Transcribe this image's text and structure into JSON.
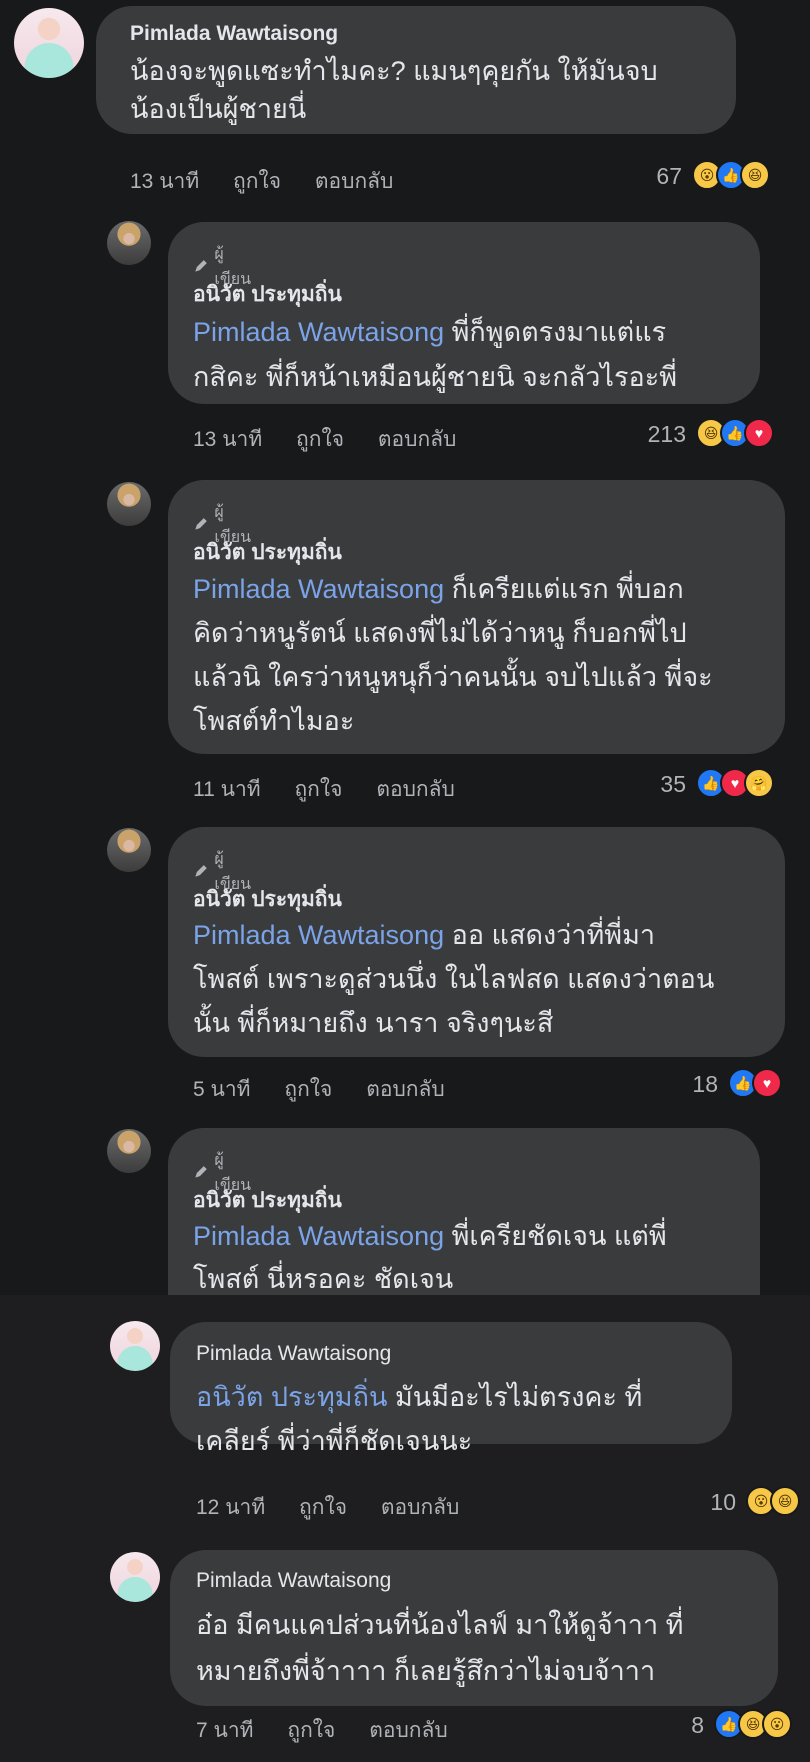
{
  "comments": [
    {
      "name": "Pimlada Wawtaisong",
      "lines": [
        "น้องจะพูดแซะทำไมคะ? แมนๆคุยกัน ให้มันจบ",
        "น้องเป็นผู้ชายนี่"
      ],
      "time": "13 นาที",
      "like": "ถูกใจ",
      "reply": "ตอบกลับ",
      "count": "67",
      "reactions": [
        "wow",
        "like",
        "haha"
      ]
    },
    {
      "badge": "ผู้เขียน",
      "name": "อนิวัต ประทุมถิ่น",
      "mention": "Pimlada Wawtaisong",
      "lines": [
        "พี่ก็พูดตรงมาแต่แร",
        "กสิคะ พี่ก็หน้าเหมือนผู้ชายนิ จะกลัวไรอะพี่"
      ],
      "time": "13 นาที",
      "like": "ถูกใจ",
      "reply": "ตอบกลับ",
      "count": "213",
      "reactions": [
        "haha",
        "like",
        "love"
      ]
    },
    {
      "badge": "ผู้เขียน",
      "name": "อนิวัต ประทุมถิ่น",
      "mention": "Pimlada Wawtaisong",
      "lines": [
        "ก็เครียแต่แรก พี่บอก",
        "คิดว่าหนูรัตน์ แสดงพี่ไม่ได้ว่าหนู ก็บอกพี่ไป",
        "แล้วนิ ใครว่าหนูหนุก็ว่าคนนั้น จบไปแล้ว พี่จะ",
        "โพสต์ทำไมอะ"
      ],
      "time": "11 นาที",
      "like": "ถูกใจ",
      "reply": "ตอบกลับ",
      "count": "35",
      "reactions": [
        "like",
        "love",
        "care"
      ]
    },
    {
      "badge": "ผู้เขียน",
      "name": "อนิวัต ประทุมถิ่น",
      "mention": "Pimlada Wawtaisong",
      "lines": [
        " ออ แสดงว่าที่พี่มา",
        "โพสต์ เพราะดูส่วนนึ่ง ในไลฟสด แสดงว่าตอน",
        "นั้น พี่ก็หมายถึง นารา จริงๆนะสี"
      ],
      "time": "5 นาที",
      "like": "ถูกใจ",
      "reply": "ตอบกลับ",
      "count": "18",
      "reactions": [
        "like",
        "love"
      ]
    },
    {
      "badge": "ผู้เขียน",
      "name": "อนิวัต ประทุมถิ่น",
      "mention": "Pimlada Wawtaisong",
      "lines": [
        "พี่เครียชัดเจน แต่พี่",
        "โพสต์ นี่หรอคะ ชัดเจน"
      ]
    },
    {
      "name": "Pimlada Wawtaisong",
      "mention": "อนิวัต ประทุมถิ่น",
      "lines": [
        " มันมีอะไรไม่ตรงคะ ที่",
        "เคลียร์ พี่ว่าพี่ก็ชัดเจนนะ"
      ],
      "time": "12 นาที",
      "like": "ถูกใจ",
      "reply": "ตอบกลับ",
      "count": "10",
      "reactions": [
        "wow",
        "haha"
      ]
    },
    {
      "name": "Pimlada Wawtaisong",
      "lines": [
        "อ๋อ มีคนแคปส่วนที่น้องไลฟ์ มาให้ดูจ้าาา ที่",
        "หมายถึงพี่จ้าาาา ก็เลยรู้สึกว่าไม่จบจ้าาา"
      ],
      "time": "7 นาที",
      "like": "ถูกใจ",
      "reply": "ตอบกลับ",
      "count": "8",
      "reactions": [
        "like",
        "haha",
        "wow"
      ]
    }
  ],
  "reaction_glyphs": {
    "like": "👍",
    "love": "♥",
    "haha": "😆",
    "wow": "😮",
    "care": "🤗"
  },
  "colors": {
    "bubble": "#3a3b3c",
    "mention": "#7ba3e8",
    "background": "#18191a",
    "like": "#2078f4",
    "love": "#f02849"
  }
}
